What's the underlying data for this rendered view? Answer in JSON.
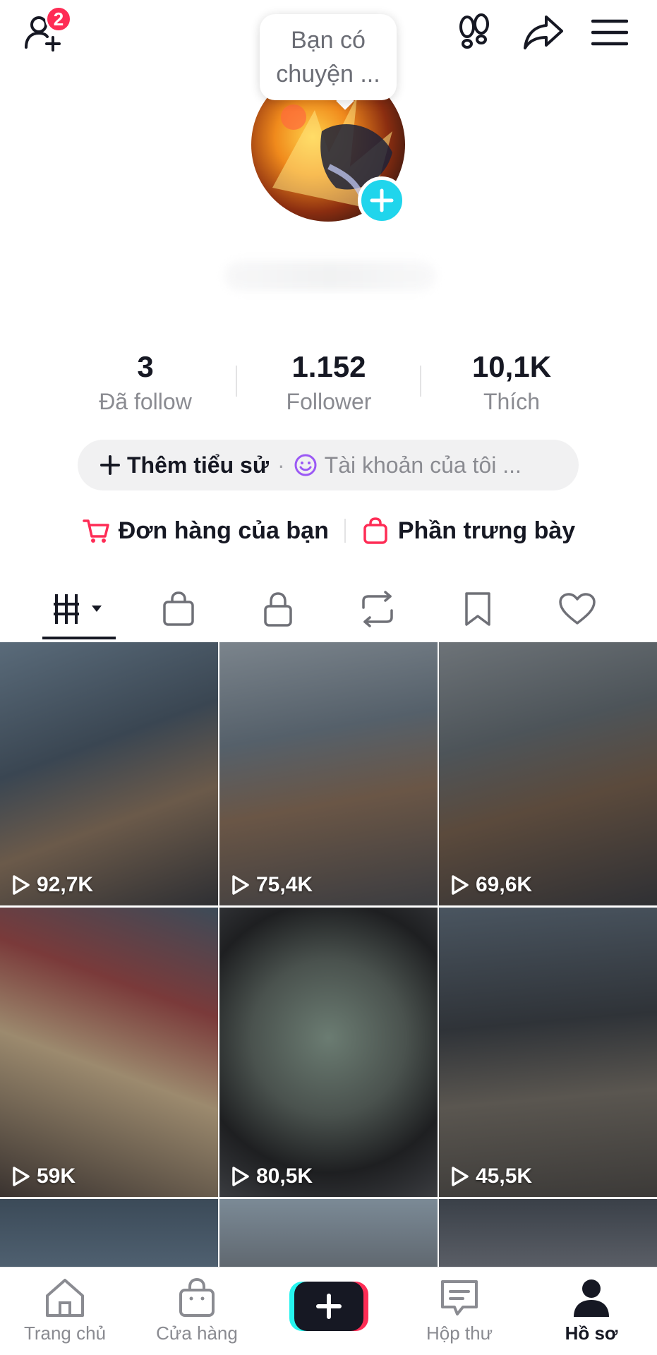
{
  "header": {
    "notification_count": "2",
    "tooltip_text": "Bạn có chuyện ...",
    "icons": [
      "add-friend-icon",
      "footprints-icon",
      "share-icon",
      "menu-icon"
    ]
  },
  "stats": [
    {
      "value": "3",
      "label": "Đã follow"
    },
    {
      "value": "1.152",
      "label": "Follower"
    },
    {
      "value": "10,1K",
      "label": "Thích"
    }
  ],
  "bio": {
    "add_label": "Thêm tiểu sử",
    "separator": "·",
    "account_label": "Tài khoản của tôi ..."
  },
  "shop": {
    "orders_label": "Đơn hàng của bạn",
    "showcase_label": "Phần trưng bày"
  },
  "tabs": [
    {
      "icon": "grid-icon",
      "active": true
    },
    {
      "icon": "shop-bag-icon",
      "active": false
    },
    {
      "icon": "lock-icon",
      "active": false
    },
    {
      "icon": "repost-icon",
      "active": false
    },
    {
      "icon": "bookmark-icon",
      "active": false
    },
    {
      "icon": "heart-icon",
      "active": false
    }
  ],
  "videos": [
    {
      "views": "92,7K"
    },
    {
      "views": "75,4K"
    },
    {
      "views": "69,6K"
    },
    {
      "views": "59K"
    },
    {
      "views": "80,5K"
    },
    {
      "views": "45,5K"
    },
    {
      "views": ""
    },
    {
      "views": ""
    },
    {
      "views": ""
    }
  ],
  "nav": {
    "home": "Trang chủ",
    "shop": "Cửa hàng",
    "inbox": "Hộp thư",
    "profile": "Hồ sơ"
  },
  "colors": {
    "accent_red": "#fe2c55",
    "accent_cyan": "#20d5ec",
    "text_primary": "#161823",
    "text_secondary": "#8a8b91"
  }
}
